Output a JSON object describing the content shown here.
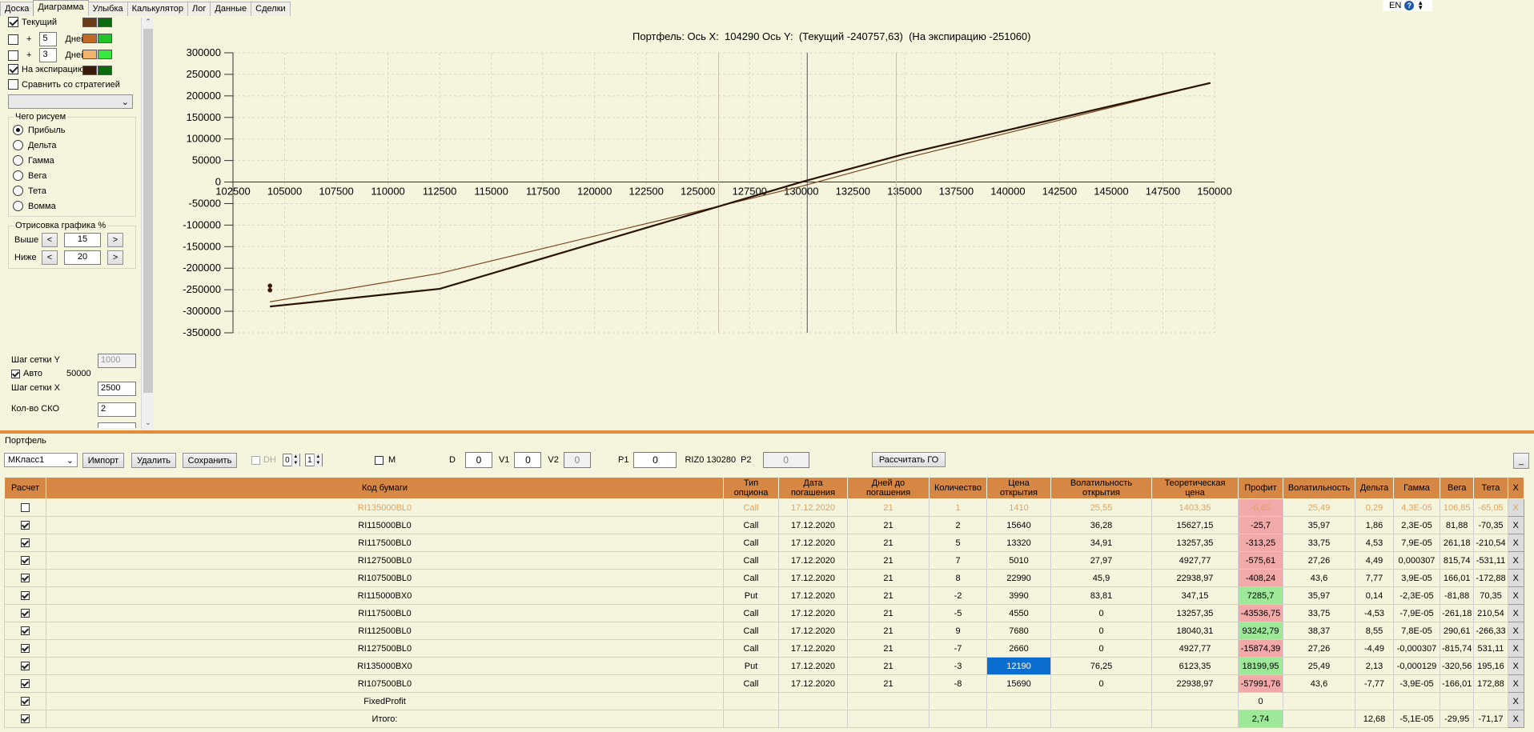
{
  "tabs": [
    "Доска",
    "Диаграмма",
    "Улыбка",
    "Калькулятор",
    "Лог",
    "Данные",
    "Сделки"
  ],
  "active_tab": "Диаграмма",
  "lang": "EN",
  "help_icon": "question-icon",
  "left": {
    "current_label": "Текущий",
    "days_prefix": "+",
    "days1": "5",
    "days_label": "Дней",
    "days2": "3",
    "expiry_label": "На экспирацию",
    "compare_label": "Сравнить со стратегией",
    "what_group": "Чего рисуем",
    "radios": [
      "Прибыль",
      "Дельта",
      "Гамма",
      "Вега",
      "Тета",
      "Вомма"
    ],
    "draw_group": "Отрисовка графика %",
    "above_label": "Выше",
    "above_value": "15",
    "below_label": "Ниже",
    "below_value": "20",
    "prev_btn": "<",
    "next_btn": ">",
    "grid_y_label": "Шаг сетки Y",
    "grid_y_value": "1000",
    "auto_label": "Авто",
    "auto_value": "50000",
    "grid_x_label": "Шаг сетки X",
    "grid_x_value": "2500",
    "sko_label": "Кол-во СКО",
    "sko_value": "2",
    "colors": {
      "current": [
        "#6b3a16",
        "#0a6b10"
      ],
      "days5": [
        "#c06a28",
        "#22c22a"
      ],
      "days3": [
        "#f2b46c",
        "#39e83c"
      ],
      "expiry": [
        "#3a1a08",
        "#0a6b10"
      ]
    }
  },
  "chart_title": "Портфель: Ось X:  104290 Ось Y:  (Текущий -240757,63)  (На экспирацию -251060)",
  "chart_data": {
    "type": "line",
    "x_ticks": [
      102500,
      105000,
      107500,
      110000,
      112500,
      115000,
      117500,
      120000,
      122500,
      125000,
      127500,
      130000,
      132500,
      135000,
      137500,
      140000,
      142500,
      145000,
      147500,
      150000
    ],
    "y_ticks": [
      300000,
      250000,
      200000,
      150000,
      100000,
      50000,
      0,
      -50000,
      -100000,
      -150000,
      -200000,
      -250000,
      -300000,
      -350000
    ],
    "xlim": [
      102500,
      150000
    ],
    "ylim": [
      -350000,
      300000
    ],
    "series": [
      {
        "color": "#2a1304",
        "width": 2.2,
        "x": [
          104290,
          112500,
          130000,
          135000,
          149800
        ],
        "y": [
          -289000,
          -248000,
          0,
          65000,
          230000
        ]
      },
      {
        "color": "#7a4a22",
        "width": 1.2,
        "x": [
          104290,
          112500,
          130000,
          135000,
          149800
        ],
        "y": [
          -278000,
          -212000,
          -10000,
          55000,
          230000
        ]
      }
    ],
    "vlines": [
      {
        "x": 126000,
        "color": "#f0a8a8"
      },
      {
        "x": 130290,
        "color": "#555555"
      },
      {
        "x": 134600,
        "color": "#f0a8a8"
      }
    ],
    "markers": [
      {
        "x": 104290,
        "y": -240758,
        "color": "#3a1a08"
      },
      {
        "x": 104290,
        "y": -251060,
        "color": "#3a1a08"
      }
    ]
  },
  "portfolio": {
    "title": "Портфель",
    "class_combo": "МКласс1",
    "import_btn": "Импорт",
    "delete_btn": "Удалить",
    "save_btn": "Сохранить",
    "dh_label": "DH",
    "dh_v1": "0",
    "dh_v2": "1",
    "m_label": "M",
    "d_label": "D",
    "d_value": "0",
    "v1_label": "V1",
    "v1_value": "0",
    "v2_label": "V2",
    "v2_value": "0",
    "p1_label": "P1",
    "p1_value": "0",
    "riz_label": "RIZ0 130280",
    "p2_label": "P2",
    "p2_value": "0",
    "calc_btn": "Рассчитать ГО",
    "min_btn": "_"
  },
  "table": {
    "columns": [
      "Расчет",
      "Код бумаги",
      "Тип опциона",
      "Дата погашения",
      "Дней до погашения",
      "Количество",
      "Цена открытия",
      "Волатильность открытия",
      "Теоретическая цена",
      "Профит",
      "Волатильность",
      "Дельта",
      "Гамма",
      "Вега",
      "Тета",
      "X"
    ],
    "rows": [
      {
        "checked": false,
        "cells": [
          "RI135000BL0",
          "Call",
          "17.12.2020",
          "21",
          "1",
          "1410",
          "25,55",
          "1403,35",
          "-6,65",
          "25,49",
          "0,29",
          "4,3E-05",
          "106,85",
          "-65,05"
        ],
        "profit_cls": "neg",
        "inactive": true
      },
      {
        "checked": true,
        "cells": [
          "RI115000BL0",
          "Call",
          "17.12.2020",
          "21",
          "2",
          "15640",
          "36,28",
          "15627,15",
          "-25,7",
          "35,97",
          "1,86",
          "2,3E-05",
          "81,88",
          "-70,35"
        ],
        "profit_cls": "neg"
      },
      {
        "checked": true,
        "cells": [
          "RI117500BL0",
          "Call",
          "17.12.2020",
          "21",
          "5",
          "13320",
          "34,91",
          "13257,35",
          "-313,25",
          "33,75",
          "4,53",
          "7,9E-05",
          "261,18",
          "-210,54"
        ],
        "profit_cls": "neg"
      },
      {
        "checked": true,
        "cells": [
          "RI127500BL0",
          "Call",
          "17.12.2020",
          "21",
          "7",
          "5010",
          "27,97",
          "4927,77",
          "-575,61",
          "27,26",
          "4,49",
          "0,000307",
          "815,74",
          "-531,11"
        ],
        "profit_cls": "neg"
      },
      {
        "checked": true,
        "cells": [
          "RI107500BL0",
          "Call",
          "17.12.2020",
          "21",
          "8",
          "22990",
          "45,9",
          "22938,97",
          "-408,24",
          "43,6",
          "7,77",
          "3,9E-05",
          "166,01",
          "-172,88"
        ],
        "profit_cls": "neg"
      },
      {
        "checked": true,
        "cells": [
          "RI115000BX0",
          "Put",
          "17.12.2020",
          "21",
          "-2",
          "3990",
          "83,81",
          "347,15",
          "7285,7",
          "35,97",
          "0,14",
          "-2,3E-05",
          "-81,88",
          "70,35"
        ],
        "profit_cls": "pos"
      },
      {
        "checked": true,
        "cells": [
          "RI117500BL0",
          "Call",
          "17.12.2020",
          "21",
          "-5",
          "4550",
          "0",
          "13257,35",
          "-43536,75",
          "33,75",
          "-4,53",
          "-7,9E-05",
          "-261,18",
          "210,54"
        ],
        "profit_cls": "neg"
      },
      {
        "checked": true,
        "cells": [
          "RI112500BL0",
          "Call",
          "17.12.2020",
          "21",
          "9",
          "7680",
          "0",
          "18040,31",
          "93242,79",
          "38,37",
          "8,55",
          "7,8E-05",
          "290,61",
          "-266,33"
        ],
        "profit_cls": "pos"
      },
      {
        "checked": true,
        "cells": [
          "RI127500BL0",
          "Call",
          "17.12.2020",
          "21",
          "-7",
          "2660",
          "0",
          "4927,77",
          "-15874,39",
          "27,26",
          "-4,49",
          "-0,000307",
          "-815,74",
          "531,11"
        ],
        "profit_cls": "neg"
      },
      {
        "checked": true,
        "cells": [
          "RI135000BX0",
          "Put",
          "17.12.2020",
          "21",
          "-3",
          "12190",
          "76,25",
          "6123,35",
          "18199,95",
          "25,49",
          "2,13",
          "-0,000129",
          "-320,56",
          "195,16"
        ],
        "profit_cls": "pos",
        "sel_col": 5
      },
      {
        "checked": true,
        "cells": [
          "RI107500BL0",
          "Call",
          "17.12.2020",
          "21",
          "-8",
          "15690",
          "0",
          "22938,97",
          "-57991,76",
          "43,6",
          "-7,77",
          "-3,9E-05",
          "-166,01",
          "172,88"
        ],
        "profit_cls": "neg"
      },
      {
        "checked": true,
        "cells": [
          "FixedProfit",
          "",
          "",
          "",
          "",
          "",
          "",
          "",
          "0",
          "",
          "",
          "",
          "",
          ""
        ],
        "profit_cls": ""
      },
      {
        "checked": true,
        "cells": [
          "Итого:",
          "",
          "",
          "",
          "",
          "",
          "",
          "",
          "2,74",
          "",
          "12,68",
          "-5,1E-05",
          "-29,95",
          "-71,17"
        ],
        "profit_cls": "pos"
      }
    ],
    "delete_label": "X"
  }
}
